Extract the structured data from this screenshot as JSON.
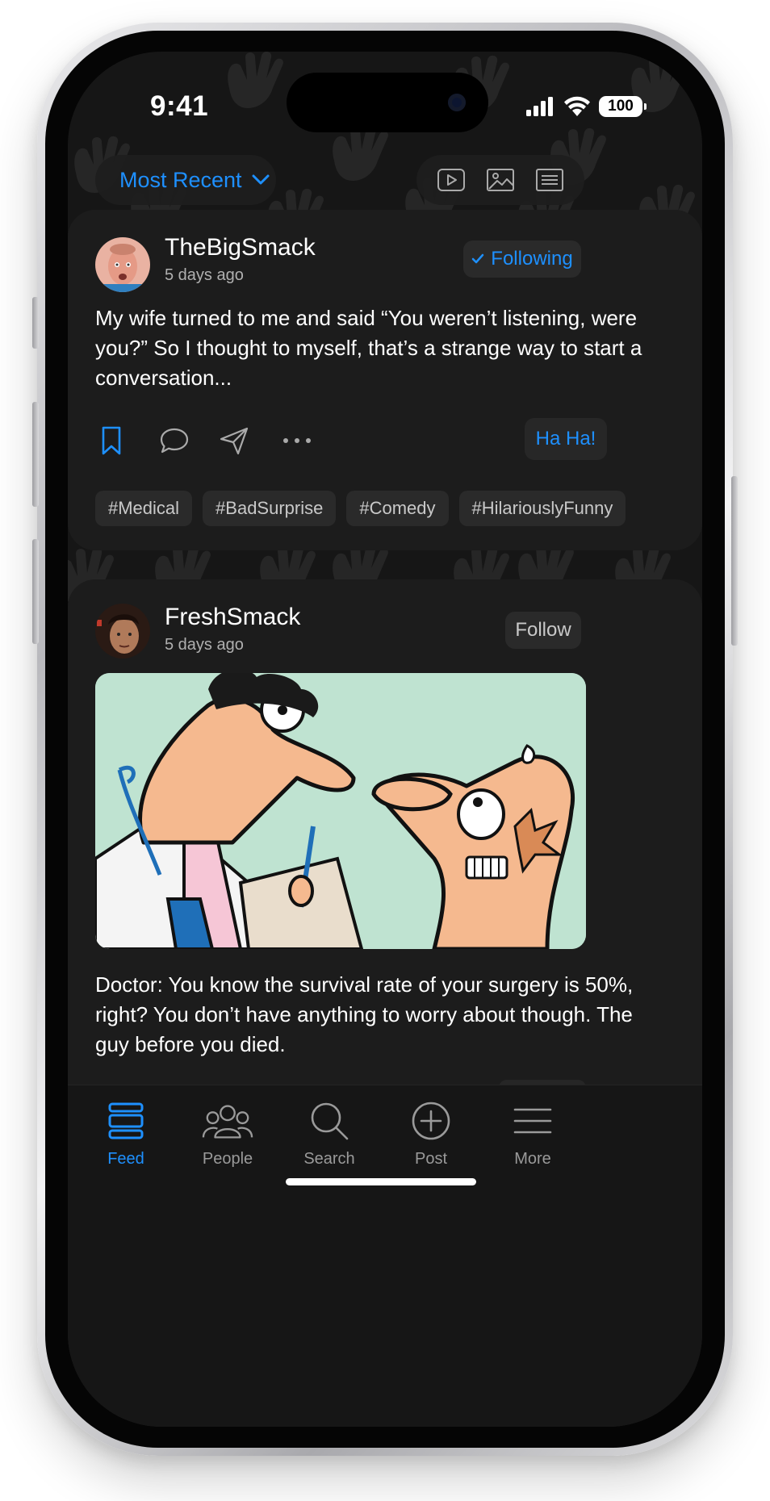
{
  "status_bar": {
    "time": "9:41",
    "battery": "100"
  },
  "filter": {
    "label": "Most Recent"
  },
  "view_icons": [
    "video-icon",
    "image-icon",
    "text-icon"
  ],
  "posts": [
    {
      "username": "TheBigSmack",
      "time": "5 days ago",
      "follow_label": "Following",
      "following": true,
      "text": "My wife turned to me and said “You weren’t listening, were you?” So I thought to myself, that’s a strange way to start a conversation...",
      "reaction_label": "Ha Ha!",
      "tags": [
        "#Medical",
        "#BadSurprise",
        "#Comedy",
        "#HilariouslyFunny"
      ]
    },
    {
      "username": "FreshSmack",
      "time": "5 days ago",
      "follow_label": "Follow",
      "following": false,
      "text": "Doctor: You know the survival rate of your surgery is 50%, right? You don’t have anything to worry about though. The guy before you died."
    }
  ],
  "tabbar": {
    "items": [
      {
        "label": "Feed",
        "icon": "feed-icon",
        "active": true
      },
      {
        "label": "People",
        "icon": "people-icon",
        "active": false
      },
      {
        "label": "Search",
        "icon": "search-icon",
        "active": false
      },
      {
        "label": "Post",
        "icon": "plus-circle-icon",
        "active": false
      },
      {
        "label": "More",
        "icon": "menu-icon",
        "active": false
      }
    ]
  },
  "colors": {
    "accent": "#1e90ff",
    "card": "#1c1c1c",
    "background": "#161616"
  }
}
